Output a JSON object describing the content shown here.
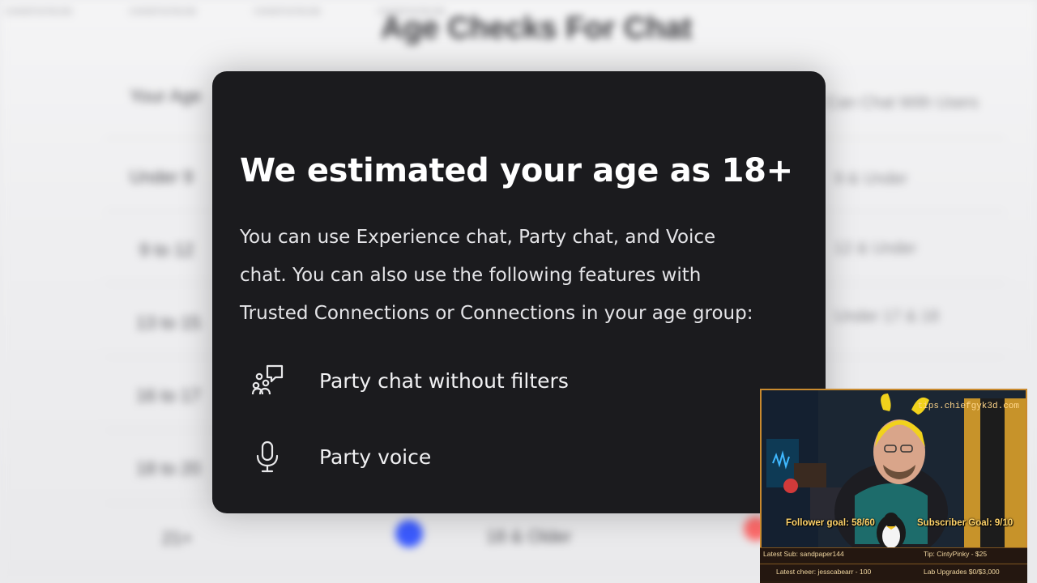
{
  "background": {
    "watermarks": [
      "CHIEFGYK3D",
      "CHIEFGYK3D",
      "CHIEFGYK3D",
      "CHIEFGYK3D"
    ],
    "title": "Age Checks For Chat",
    "left_column": [
      "Your Age",
      "Under 9",
      "9 to 12",
      "13 to 15",
      "16 to 17",
      "18 to 20",
      "21+"
    ],
    "right_column": [
      "Can Chat With Users",
      "9 & Under",
      "12 & Under",
      "Under 17 & 18",
      "",
      ""
    ],
    "bottom_label": "18 & Older"
  },
  "modal": {
    "title": "We estimated your age as 18+",
    "body_lines": [
      "You can use Experience chat, Party chat, and Voice",
      "chat. You can also use the following features with",
      "Trusted Connections or Connections in your age group:"
    ],
    "features": [
      {
        "icon": "party-chat-icon",
        "label": "Party chat without filters"
      },
      {
        "icon": "microphone-icon",
        "label": "Party voice"
      }
    ]
  },
  "stream_overlay": {
    "tips_url": "tips.chiefgyk3d.com",
    "follower_goal": "Follower goal: 58/60",
    "subscriber_goal": "Subscriber Goal: 9/10",
    "latest_sub": "Latest Sub: sandpaper144",
    "tip": "Tip: CintyPinky - $25",
    "latest_cheer": "Latest cheer: jesscabearr - 100",
    "lab_upgrades": "Lab Upgrades $0/$3,000"
  },
  "colors": {
    "modal_bg": "#1b1b1e",
    "modal_text": "#ffffff",
    "overlay_accent": "#c98a2e",
    "goal_text": "#ffd36a"
  }
}
